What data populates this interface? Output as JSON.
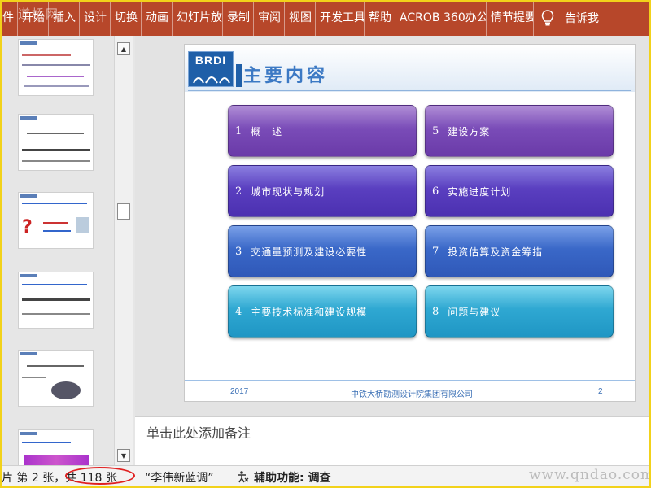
{
  "ribbon": {
    "tabs": [
      "件",
      "开始",
      "插入",
      "设计",
      "切换",
      "动画",
      "幻灯片放",
      "录制",
      "审阅",
      "视图",
      "开发工具",
      "帮助",
      "ACROBAT",
      "360办公",
      "情节提要"
    ],
    "tell_me": "告诉我",
    "watermark": "道桥网"
  },
  "slide": {
    "logo_text": "BRDI",
    "title": "主要内容",
    "items": [
      {
        "num": "1",
        "text": "概　述"
      },
      {
        "num": "2",
        "text": "城市现状与规划"
      },
      {
        "num": "3",
        "text": "交通量预测及建设必要性"
      },
      {
        "num": "4",
        "text": "主要技术标准和建设规模"
      },
      {
        "num": "5",
        "text": "建设方案"
      },
      {
        "num": "6",
        "text": "实施进度计划"
      },
      {
        "num": "7",
        "text": "投资估算及资金筹措"
      },
      {
        "num": "8",
        "text": "问题与建议"
      }
    ],
    "footer_year": "2017",
    "footer_company": "中铁大桥勘测设计院集团有限公司",
    "footer_page": "2"
  },
  "notes": {
    "placeholder": "单击此处添加备注"
  },
  "statusbar": {
    "slide_info": "片 第 2 张，共 118 张",
    "theme": "“李伟新蓝调”",
    "accessibility": "辅助功能: 调查",
    "watermark": "www.qndao.com"
  },
  "colors": {
    "ribbon": "#b7472a",
    "accent": "#1f5fa8",
    "highlight_circle": "#e02020"
  }
}
